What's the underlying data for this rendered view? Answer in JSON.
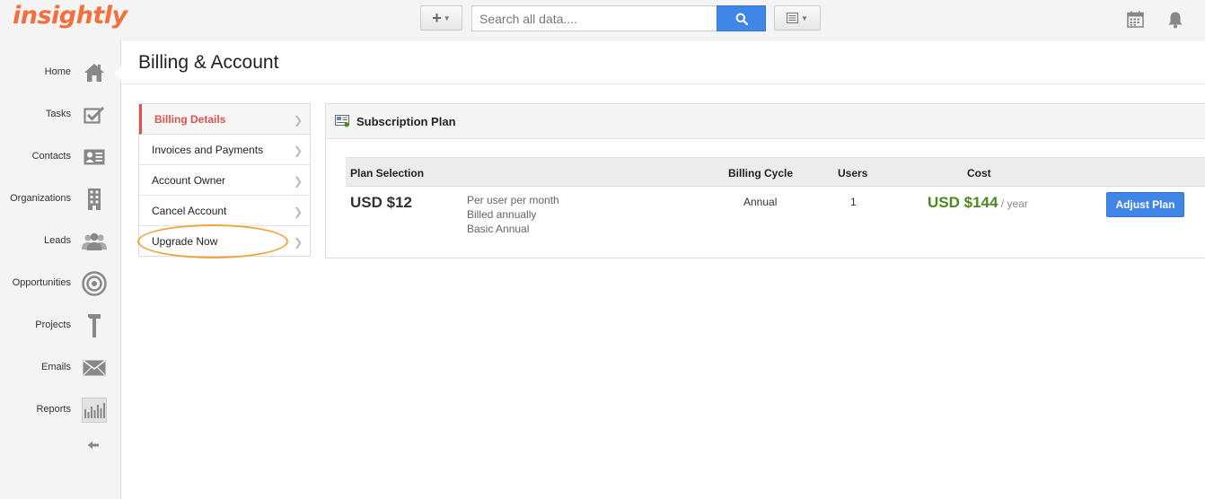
{
  "brand": {
    "logo_text": "insightly",
    "accent": "#f36f3b"
  },
  "topbar": {
    "add_icon": "plus-icon",
    "search": {
      "placeholder": "Search all data....",
      "value": ""
    },
    "search_button_icon": "search-icon",
    "view_icon": "list-icon",
    "calendar_icon": "calendar-icon",
    "notifications_icon": "bell-icon"
  },
  "sidebar": {
    "items": [
      {
        "label": "Home",
        "icon": "home-icon"
      },
      {
        "label": "Tasks",
        "icon": "checkbox-icon"
      },
      {
        "label": "Contacts",
        "icon": "contact-card-icon"
      },
      {
        "label": "Organizations",
        "icon": "building-icon"
      },
      {
        "label": "Leads",
        "icon": "people-icon"
      },
      {
        "label": "Opportunities",
        "icon": "target-icon"
      },
      {
        "label": "Projects",
        "icon": "hammer-icon"
      },
      {
        "label": "Emails",
        "icon": "envelope-icon"
      },
      {
        "label": "Reports",
        "icon": "bar-chart-icon"
      }
    ],
    "collapse_icon": "arrow-left-icon"
  },
  "page": {
    "title": "Billing & Account"
  },
  "subnav": {
    "items": [
      {
        "label": "Billing Details",
        "active": true
      },
      {
        "label": "Invoices and Payments",
        "active": false
      },
      {
        "label": "Account Owner",
        "active": false
      },
      {
        "label": "Cancel Account",
        "active": false
      },
      {
        "label": "Upgrade Now",
        "active": false
      }
    ]
  },
  "subscription": {
    "title": "Subscription Plan",
    "headers": {
      "plan_selection": "Plan Selection",
      "billing_cycle": "Billing Cycle",
      "users": "Users",
      "cost": "Cost"
    },
    "row": {
      "price": "USD $12",
      "desc_line1": "Per user per month",
      "desc_line2": "Billed annually",
      "desc_line3": "Basic Annual",
      "billing_cycle": "Annual",
      "users": "1",
      "cost": "USD $144",
      "cost_period": " / year"
    },
    "adjust_label": "Adjust Plan"
  },
  "colors": {
    "primary_button": "#3f86e6",
    "cost_green": "#4a8a1d",
    "active_red": "#d9534f",
    "highlight_orange": "#f0a33a"
  }
}
